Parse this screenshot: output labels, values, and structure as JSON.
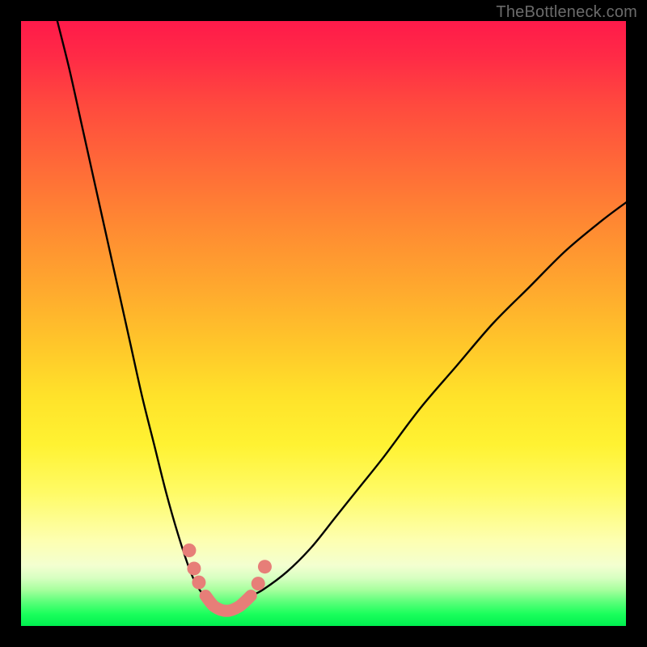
{
  "watermark": "TheBottleneck.com",
  "chart_data": {
    "type": "line",
    "title": "",
    "xlabel": "",
    "ylabel": "",
    "xlim": [
      0,
      100
    ],
    "ylim": [
      0,
      100
    ],
    "grid": false,
    "legend": false,
    "background_gradient": {
      "orientation": "vertical",
      "stops": [
        {
          "pos": 0.0,
          "color": "#ff1a4a"
        },
        {
          "pos": 0.3,
          "color": "#ff7a34"
        },
        {
          "pos": 0.55,
          "color": "#ffd02a"
        },
        {
          "pos": 0.78,
          "color": "#fffb66"
        },
        {
          "pos": 0.92,
          "color": "#d8ffc2"
        },
        {
          "pos": 1.0,
          "color": "#00ef4f"
        }
      ]
    },
    "series": [
      {
        "name": "left-descent",
        "color": "#000000",
        "x": [
          6,
          8,
          10,
          12,
          14,
          16,
          18,
          20,
          22,
          24,
          26,
          28,
          29.5,
          30.5
        ],
        "y": [
          100,
          92,
          83,
          74,
          65,
          56,
          47,
          38,
          30,
          22,
          15,
          9,
          6,
          5
        ]
      },
      {
        "name": "right-ascent",
        "color": "#000000",
        "x": [
          38,
          40,
          44,
          48,
          52,
          56,
          60,
          66,
          72,
          78,
          84,
          90,
          96,
          100
        ],
        "y": [
          5,
          6,
          9,
          13,
          18,
          23,
          28,
          36,
          43,
          50,
          56,
          62,
          67,
          70
        ]
      },
      {
        "name": "valley-floor-highlight",
        "color": "#e77e78",
        "x": [
          30.5,
          32,
          34,
          36,
          38
        ],
        "y": [
          5,
          3.2,
          2.5,
          3.2,
          5
        ],
        "style": "thick-rounded"
      },
      {
        "name": "left-shoulder-dots",
        "color": "#e77e78",
        "type_override": "scatter",
        "x": [
          27.8,
          28.6,
          29.4
        ],
        "y": [
          12.5,
          9.5,
          7.2
        ]
      },
      {
        "name": "right-shoulder-dots",
        "color": "#e77e78",
        "type_override": "scatter",
        "x": [
          39.2,
          40.3
        ],
        "y": [
          7.0,
          9.8
        ]
      }
    ]
  }
}
